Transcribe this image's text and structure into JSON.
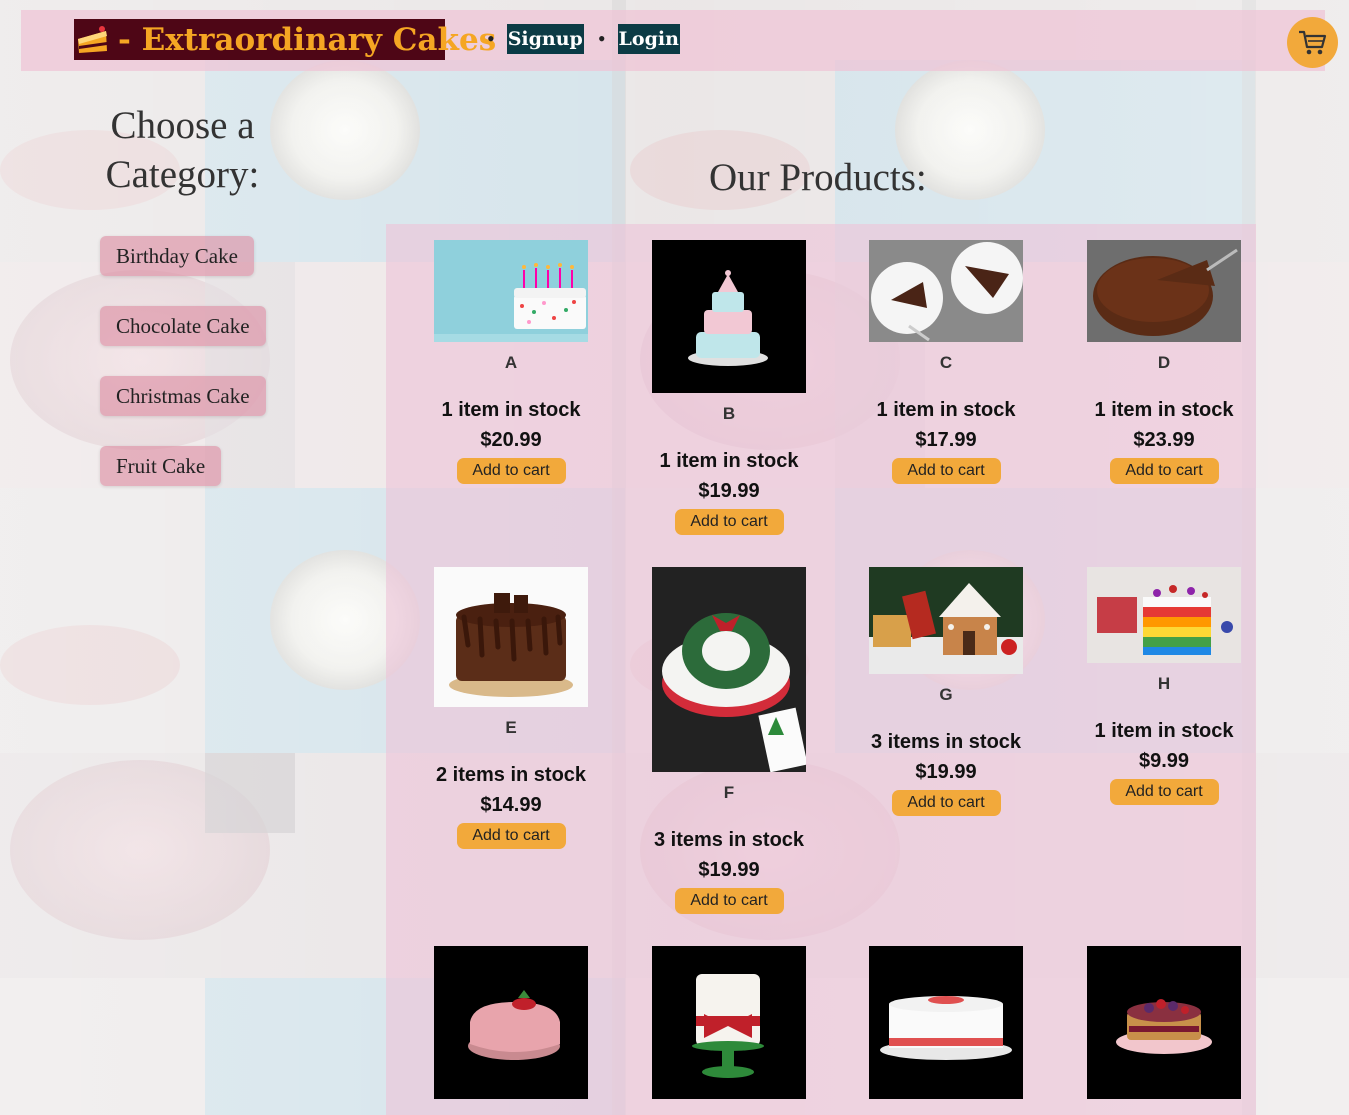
{
  "header": {
    "brand": "- Extraordinary Cakes",
    "nav": [
      {
        "label": "Signup"
      },
      {
        "label": "Login"
      }
    ]
  },
  "categories": {
    "title": "Choose a Category:",
    "items": [
      {
        "label": "Birthday Cake"
      },
      {
        "label": "Chocolate Cake"
      },
      {
        "label": "Christmas Cake"
      },
      {
        "label": "Fruit Cake"
      }
    ]
  },
  "products": {
    "title": "Our Products:",
    "add_label": "Add to cart",
    "items": [
      {
        "name": "A",
        "stock": "1 item in stock",
        "price": "$20.99"
      },
      {
        "name": "B",
        "stock": "1 item in stock",
        "price": "$19.99"
      },
      {
        "name": "C",
        "stock": "1 item in stock",
        "price": "$17.99"
      },
      {
        "name": "D",
        "stock": "1 item in stock",
        "price": "$23.99"
      },
      {
        "name": "E",
        "stock": "2 items in stock",
        "price": "$14.99"
      },
      {
        "name": "F",
        "stock": "3 items in stock",
        "price": "$19.99"
      },
      {
        "name": "G",
        "stock": "3 items in stock",
        "price": "$19.99"
      },
      {
        "name": "H",
        "stock": "1 item in stock",
        "price": "$9.99"
      }
    ]
  },
  "colors": {
    "accent": "#f2a93b",
    "brand_bg": "#4e0616",
    "nav_bg": "#0c3b45",
    "panel": "#eec4d8"
  },
  "icons": {
    "brand": "cake-slice-icon",
    "cart": "shopping-cart-icon"
  }
}
